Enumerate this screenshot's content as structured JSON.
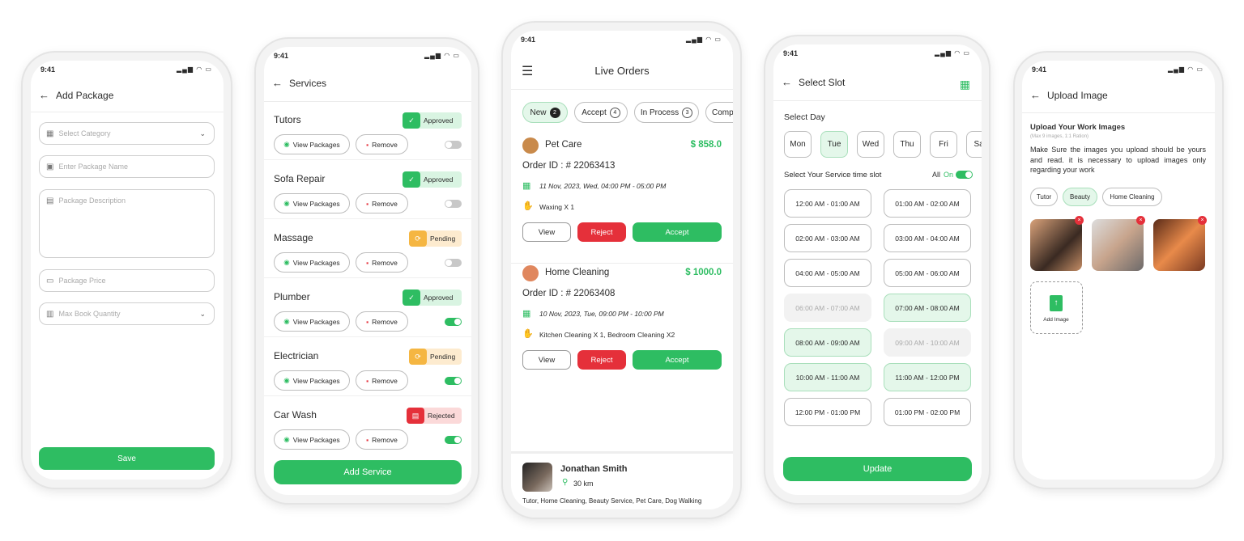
{
  "status_time": "9:41",
  "colors": {
    "green": "#2ebd62",
    "light_green": "#e4f7ea",
    "red": "#e5303a",
    "orange": "#f5b642",
    "light_orange": "#fdebcf"
  },
  "add_package": {
    "title": "Add Package",
    "fields": [
      {
        "placeholder": "Select Category",
        "icon": "category-icon",
        "dropdown": true
      },
      {
        "placeholder": "Enter Package Name",
        "icon": "name-icon",
        "dropdown": false
      },
      {
        "placeholder": "Package Description",
        "icon": "document-icon",
        "dropdown": false
      },
      {
        "placeholder": "Package Price",
        "icon": "money-icon",
        "dropdown": false
      },
      {
        "placeholder": "Max Book Quantity",
        "icon": "quantity-icon",
        "dropdown": true
      }
    ],
    "save_label": "Save"
  },
  "services": {
    "title": "Services",
    "view_label": "View Packages",
    "remove_label": "Remove",
    "items": [
      {
        "name": "Tutors",
        "status": "Approved",
        "enabled": false
      },
      {
        "name": "Sofa Repair",
        "status": "Approved",
        "enabled": false
      },
      {
        "name": "Massage",
        "status": "Pending",
        "enabled": false
      },
      {
        "name": "Plumber",
        "status": "Approved",
        "enabled": true
      },
      {
        "name": "Electrician",
        "status": "Pending",
        "enabled": true
      },
      {
        "name": "Car Wash",
        "status": "Rejected",
        "enabled": true
      }
    ],
    "add_label": "Add Service"
  },
  "live_orders": {
    "title": "Live Orders",
    "tabs": [
      {
        "label": "New",
        "count": "2",
        "active": true
      },
      {
        "label": "Accept",
        "count": "4",
        "active": false
      },
      {
        "label": "In Process",
        "count": "3",
        "active": false
      },
      {
        "label": "Comp",
        "count": "",
        "active": false
      }
    ],
    "orders": [
      {
        "service": "Pet Care",
        "price": "$ 858.0",
        "order_id": "Order ID : # 22063413",
        "datetime": "11 Nov, 2023, Wed, 04:00 PM - 05:00 PM",
        "items": "Waxing X 1"
      },
      {
        "service": "Home Cleaning",
        "price": "$ 1000.0",
        "order_id": "Order ID : # 22063408",
        "datetime": "10 Nov, 2023, Tue, 09:00 PM - 10:00 PM",
        "items": "Kitchen Cleaning X 1, Bedroom Cleaning X2"
      }
    ],
    "view_label": "View",
    "reject_label": "Reject",
    "accept_label": "Accept",
    "provider": {
      "name": "Jonathan Smith",
      "distance": "30 km",
      "services": "Tutor, Home Cleaning, Beauty Service, Pet Care, Dog Walking"
    }
  },
  "select_slot": {
    "title": "Select Slot",
    "day_label": "Select Day",
    "days": [
      {
        "label": "Mon",
        "selected": false
      },
      {
        "label": "Tue",
        "selected": true
      },
      {
        "label": "Wed",
        "selected": false
      },
      {
        "label": "Thu",
        "selected": false
      },
      {
        "label": "Fri",
        "selected": false
      },
      {
        "label": "Sat",
        "selected": false
      }
    ],
    "slot_label": "Select Your Service time slot",
    "all_label": "All",
    "all_state": "On",
    "all_on": true,
    "slots": [
      {
        "label": "12:00 AM - 01:00 AM",
        "state": "available"
      },
      {
        "label": "01:00 AM - 02:00 AM",
        "state": "available"
      },
      {
        "label": "02:00 AM - 03:00 AM",
        "state": "available"
      },
      {
        "label": "03:00 AM - 04:00 AM",
        "state": "available"
      },
      {
        "label": "04:00 AM - 05:00 AM",
        "state": "available"
      },
      {
        "label": "05:00 AM - 06:00 AM",
        "state": "available"
      },
      {
        "label": "06:00 AM - 07:00 AM",
        "state": "disabled"
      },
      {
        "label": "07:00 AM - 08:00 AM",
        "state": "selected"
      },
      {
        "label": "08:00 AM - 09:00 AM",
        "state": "selected"
      },
      {
        "label": "09:00 AM - 10:00 AM",
        "state": "disabled"
      },
      {
        "label": "10:00 AM - 11:00 AM",
        "state": "selected"
      },
      {
        "label": "11:00 AM - 12:00 PM",
        "state": "selected"
      },
      {
        "label": "12:00 PM - 01:00 PM",
        "state": "available"
      },
      {
        "label": "01:00 PM - 02:00 PM",
        "state": "available"
      }
    ],
    "update_label": "Update"
  },
  "upload_image": {
    "title": "Upload Image",
    "heading": "Upload Your Work Images",
    "hint": "(Max 9 images, 1:1 Ration)",
    "description": "Make Sure the images you upload should be yours and read. it is necessary to upload images only regarding your work",
    "chips": [
      {
        "label": "Tutor",
        "active": false
      },
      {
        "label": "Beauty",
        "active": true
      },
      {
        "label": "Home Cleaning",
        "active": false
      }
    ],
    "images": [
      "makeup-compact-photo",
      "facial-treatment-photo",
      "face-portrait-photo"
    ],
    "add_label": "Add Image"
  }
}
